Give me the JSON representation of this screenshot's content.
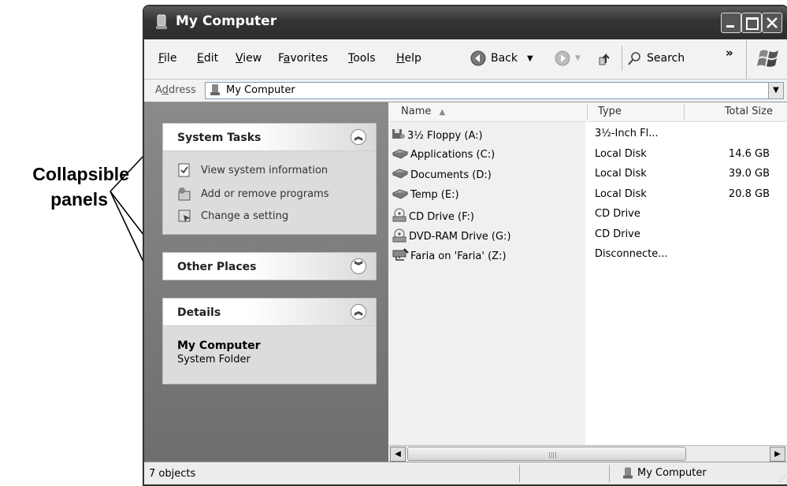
{
  "callout": {
    "line1": "Collapsible",
    "line2": "panels"
  },
  "window": {
    "title": "My Computer"
  },
  "menu": [
    "File",
    "Edit",
    "View",
    "Favorites",
    "Tools",
    "Help"
  ],
  "toolbar": {
    "back_label": "Back",
    "search_label": "Search",
    "more": "»"
  },
  "address": {
    "label": "Address",
    "value": "My Computer"
  },
  "panels": {
    "system_tasks": {
      "title": "System Tasks",
      "items": [
        "View system information",
        "Add or remove programs",
        "Change a setting"
      ]
    },
    "other_places": {
      "title": "Other Places"
    },
    "details": {
      "title": "Details",
      "name": "My Computer",
      "kind": "System Folder"
    }
  },
  "columns": {
    "name": "Name",
    "type": "Type",
    "total_size": "Total Size"
  },
  "files": [
    {
      "name": "3½ Floppy (A:)",
      "type": "3½-Inch Fl...",
      "size": "",
      "icon": "floppy-icon"
    },
    {
      "name": "Applications (C:)",
      "type": "Local Disk",
      "size": "14.6 GB",
      "icon": "hard-disk-icon"
    },
    {
      "name": "Documents (D:)",
      "type": "Local Disk",
      "size": "39.0 GB",
      "icon": "hard-disk-icon"
    },
    {
      "name": "Temp (E:)",
      "type": "Local Disk",
      "size": "20.8 GB",
      "icon": "hard-disk-icon"
    },
    {
      "name": "CD Drive (F:)",
      "type": "CD Drive",
      "size": "",
      "icon": "cd-drive-icon"
    },
    {
      "name": "DVD-RAM Drive (G:)",
      "type": "CD Drive",
      "size": "",
      "icon": "cd-drive-icon"
    },
    {
      "name": "Faria on 'Faria' (Z:)",
      "type": "Disconnecte...",
      "size": "",
      "icon": "network-drive-icon"
    }
  ],
  "status": {
    "count": "7 objects",
    "location": "My Computer"
  }
}
